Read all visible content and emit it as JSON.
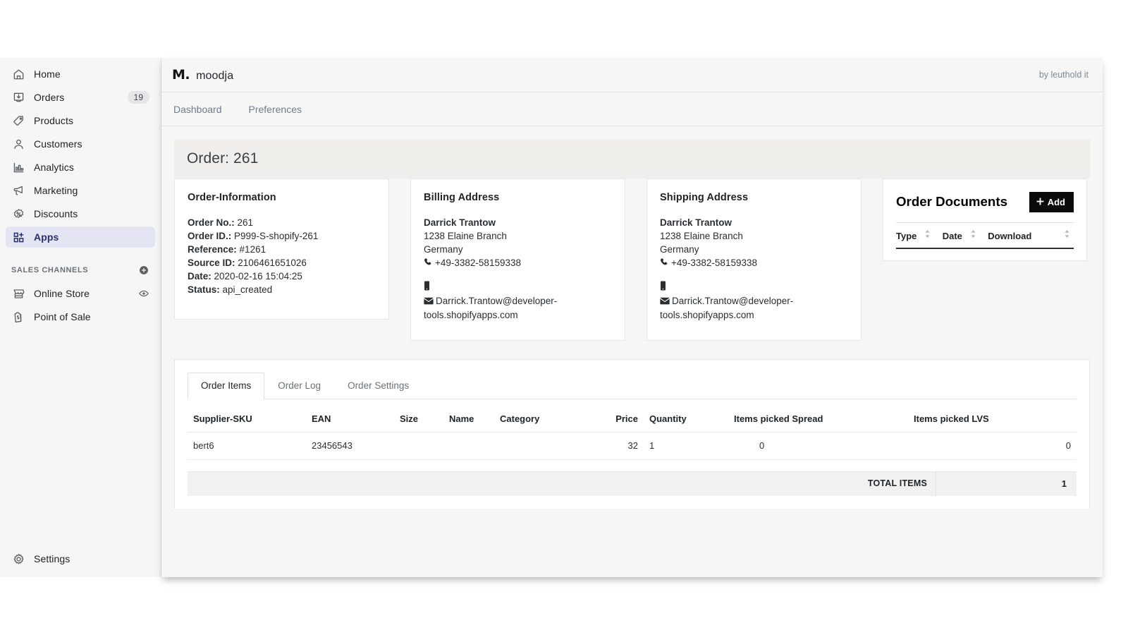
{
  "sidebar": {
    "items": [
      {
        "label": "Home",
        "icon": "home-icon",
        "badge": null
      },
      {
        "label": "Orders",
        "icon": "orders-inbox-icon",
        "badge": "19"
      },
      {
        "label": "Products",
        "icon": "tag-icon",
        "badge": null
      },
      {
        "label": "Customers",
        "icon": "person-icon",
        "badge": null
      },
      {
        "label": "Analytics",
        "icon": "bar-chart-icon",
        "badge": null
      },
      {
        "label": "Marketing",
        "icon": "megaphone-icon",
        "badge": null
      },
      {
        "label": "Discounts",
        "icon": "discount-percent-icon",
        "badge": null
      },
      {
        "label": "Apps",
        "icon": "apps-grid-plus-icon",
        "badge": null
      }
    ],
    "active_item": "Apps",
    "sales_channels": {
      "title": "SALES CHANNELS",
      "add_icon": "plus-circle-icon",
      "items": [
        {
          "label": "Online Store",
          "icon": "storefront-icon",
          "trailing_icon": "eye-icon"
        },
        {
          "label": "Point of Sale",
          "icon": "shopify-bag-icon",
          "trailing_icon": null
        }
      ]
    },
    "settings": {
      "label": "Settings",
      "icon": "gear-icon"
    }
  },
  "app": {
    "brand_mark": "M.",
    "brand_name": "moodja",
    "by_line": "by leuthold it",
    "tabs": [
      {
        "label": "Dashboard"
      },
      {
        "label": "Preferences"
      }
    ]
  },
  "order": {
    "title": "Order: 261",
    "information": {
      "heading": "Order-Information",
      "rows": [
        {
          "label": "Order No.:",
          "value": "261"
        },
        {
          "label": "Order ID.:",
          "value": "P999-S-shopify-261"
        },
        {
          "label": "Reference:",
          "value": "#1261"
        },
        {
          "label": "Source ID:",
          "value": "2106461651026"
        },
        {
          "label": "Date:",
          "value": "2020-02-16 15:04:25"
        },
        {
          "label": "Status:",
          "value": "api_created"
        }
      ]
    },
    "billing_address": {
      "heading": "Billing Address",
      "name": "Darrick Trantow",
      "street": "1238 Elaine Branch",
      "country": "Germany",
      "phone": "+49-3382-58159338",
      "mobile": "",
      "email": "Darrick.Trantow@developer-tools.shopifyapps.com",
      "phone_icon": "phone-icon",
      "mobile_icon": "mobile-phone-icon",
      "email_icon": "envelope-icon"
    },
    "shipping_address": {
      "heading": "Shipping Address",
      "name": "Darrick Trantow",
      "street": "1238 Elaine Branch",
      "country": "Germany",
      "phone": "+49-3382-58159338",
      "mobile": "",
      "email": "Darrick.Trantow@developer-tools.shopifyapps.com",
      "phone_icon": "phone-icon",
      "mobile_icon": "mobile-phone-icon",
      "email_icon": "envelope-icon"
    },
    "documents": {
      "heading": "Order Documents",
      "add_label": "Add",
      "add_icon": "plus-icon",
      "columns": [
        {
          "label": "Type",
          "sortable": true
        },
        {
          "label": "Date",
          "sortable": true
        },
        {
          "label": "Download",
          "sortable": true
        }
      ],
      "rows": []
    },
    "item_tabs": [
      {
        "label": "Order Items",
        "active": true
      },
      {
        "label": "Order Log",
        "active": false
      },
      {
        "label": "Order Settings",
        "active": false
      }
    ],
    "items_table": {
      "columns": [
        "Supplier-SKU",
        "EAN",
        "Size",
        "Name",
        "Category",
        "Price",
        "Quantity",
        "Items picked Spread",
        "Items picked LVS"
      ],
      "rows": [
        {
          "supplier_sku": "bert6",
          "ean": "23456543",
          "size": "",
          "name": "",
          "category": "",
          "price": "32",
          "quantity": "1",
          "items_picked_spread": "0",
          "items_picked_lvs": "0"
        }
      ],
      "total_label": "TOTAL ITEMS",
      "total_value": "1"
    }
  },
  "colors": {
    "sidebar_bg": "#f6f6f7",
    "active_nav_bg": "#e4e5f2",
    "active_nav_text": "#2c2f6e",
    "title_bar_bg": "#efeeeb",
    "add_button_bg": "#0b0b0b",
    "total_row_bg": "#f1f1f2"
  }
}
